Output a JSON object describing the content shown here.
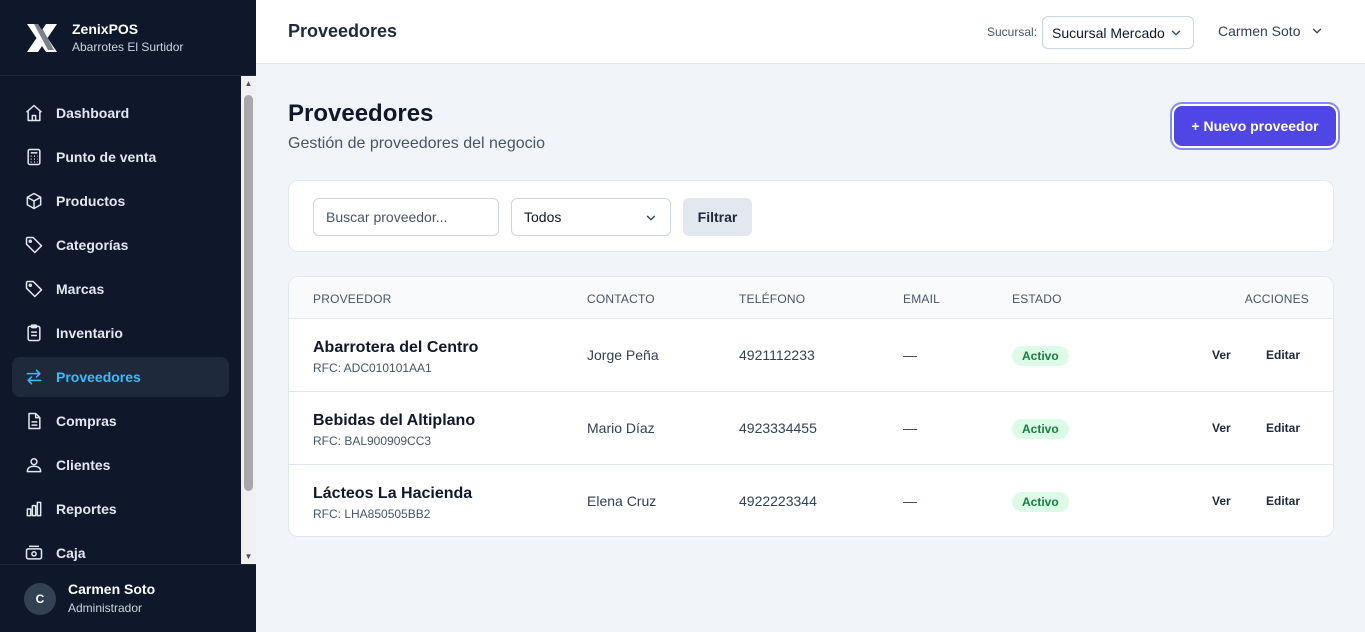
{
  "brand": {
    "name": "ZenixPOS",
    "store": "Abarrotes El Surtidor"
  },
  "nav": [
    {
      "label": "Dashboard",
      "icon": "home-icon"
    },
    {
      "label": "Punto de venta",
      "icon": "calculator-icon"
    },
    {
      "label": "Productos",
      "icon": "box-icon"
    },
    {
      "label": "Categorías",
      "icon": "tag-icon"
    },
    {
      "label": "Marcas",
      "icon": "tag-icon"
    },
    {
      "label": "Inventario",
      "icon": "clipboard-icon"
    },
    {
      "label": "Proveedores",
      "icon": "arrows-exchange-icon",
      "active": true
    },
    {
      "label": "Compras",
      "icon": "document-icon"
    },
    {
      "label": "Clientes",
      "icon": "users-icon"
    },
    {
      "label": "Reportes",
      "icon": "bar-chart-icon"
    },
    {
      "label": "Caja",
      "icon": "cash-icon"
    }
  ],
  "user": {
    "initial": "C",
    "name": "Carmen Soto",
    "role": "Administrador"
  },
  "topbar": {
    "title": "Proveedores",
    "branch_label": "Sucursal:",
    "branch_value": "Sucursal Mercado",
    "user_name": "Carmen Soto"
  },
  "page": {
    "title": "Proveedores",
    "subtitle": "Gestión de proveedores del negocio",
    "new_button": "+ Nuevo proveedor"
  },
  "filters": {
    "search_placeholder": "Buscar proveedor...",
    "status_value": "Todos",
    "filter_button": "Filtrar"
  },
  "table": {
    "headers": [
      "PROVEEDOR",
      "CONTACTO",
      "TELÉFONO",
      "EMAIL",
      "ESTADO",
      "ACCIONES"
    ],
    "rows": [
      {
        "name": "Abarrotera del Centro",
        "rfc": "RFC: ADC010101AA1",
        "contact": "Jorge Peña",
        "phone": "4921112233",
        "email": "—",
        "status": "Activo"
      },
      {
        "name": "Bebidas del Altiplano",
        "rfc": "RFC: BAL900909CC3",
        "contact": "Mario Díaz",
        "phone": "4923334455",
        "email": "—",
        "status": "Activo"
      },
      {
        "name": "Lácteos La Hacienda",
        "rfc": "RFC: LHA850505BB2",
        "contact": "Elena Cruz",
        "phone": "4922223344",
        "email": "—",
        "status": "Activo"
      }
    ],
    "action_view": "Ver",
    "action_edit": "Editar"
  },
  "colors": {
    "sidebar_bg": "#0f172a",
    "active_accent": "#38bdf8",
    "primary_button": "#4f46e5",
    "badge_bg": "#dcfce7",
    "badge_text": "#15803d"
  }
}
